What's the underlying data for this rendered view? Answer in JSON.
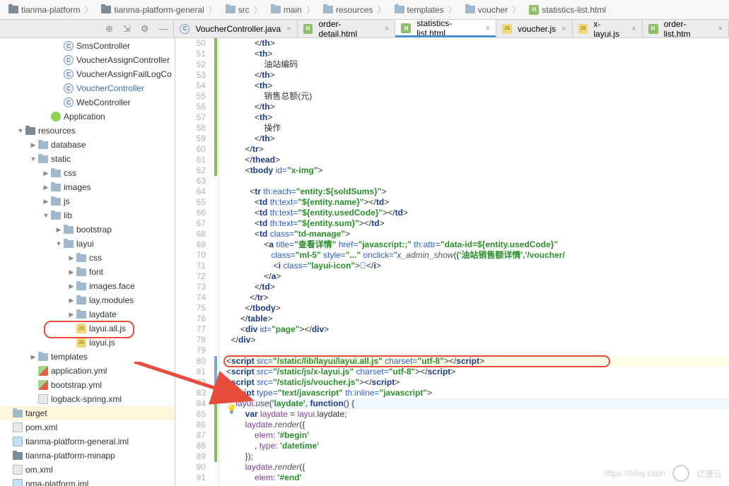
{
  "breadcrumb": [
    {
      "icon": "folder-dark",
      "label": "tianma-platform"
    },
    {
      "icon": "folder-dark",
      "label": "tianma-platform-general"
    },
    {
      "icon": "folder",
      "label": "src"
    },
    {
      "icon": "folder",
      "label": "main"
    },
    {
      "icon": "folder",
      "label": "resources"
    },
    {
      "icon": "folder",
      "label": "templates"
    },
    {
      "icon": "folder",
      "label": "voucher"
    },
    {
      "icon": "html",
      "label": "statistics-list.html"
    }
  ],
  "tool_icons": [
    "target",
    "expand",
    "gear",
    "collapse"
  ],
  "tabs": {
    "items": [
      {
        "icon": "java",
        "label": "VoucherController.java",
        "active": false
      },
      {
        "icon": "html",
        "label": "order-detail.html",
        "active": false
      },
      {
        "icon": "html",
        "label": "statistics-list.html",
        "active": true
      },
      {
        "icon": "js",
        "label": "voucher.js",
        "active": false
      },
      {
        "icon": "js",
        "label": "x-layui.js",
        "active": false
      },
      {
        "icon": "html",
        "label": "order-list.htm",
        "active": false
      }
    ]
  },
  "tree": [
    {
      "d": 4,
      "a": "",
      "i": "java",
      "t": "SmsController",
      "link": false
    },
    {
      "d": 4,
      "a": "",
      "i": "java",
      "t": "VoucherAssignController",
      "link": false,
      "trunc": true
    },
    {
      "d": 4,
      "a": "",
      "i": "java",
      "t": "VoucherAssignFailLogCo",
      "link": false,
      "trunc": true
    },
    {
      "d": 4,
      "a": "",
      "i": "java",
      "t": "VoucherController",
      "link": true
    },
    {
      "d": 4,
      "a": "",
      "i": "java",
      "t": "WebController",
      "link": false
    },
    {
      "d": 3,
      "a": "",
      "i": "spring",
      "t": "Application",
      "link": false
    },
    {
      "d": 1,
      "a": "▼",
      "i": "folder-dark",
      "t": "resources",
      "link": false
    },
    {
      "d": 2,
      "a": "▶",
      "i": "folder",
      "t": "database",
      "link": false
    },
    {
      "d": 2,
      "a": "▼",
      "i": "folder",
      "t": "static",
      "link": false
    },
    {
      "d": 3,
      "a": "▶",
      "i": "folder",
      "t": "css",
      "link": false
    },
    {
      "d": 3,
      "a": "▶",
      "i": "folder",
      "t": "images",
      "link": false
    },
    {
      "d": 3,
      "a": "▶",
      "i": "folder",
      "t": "js",
      "link": false
    },
    {
      "d": 3,
      "a": "▼",
      "i": "folder",
      "t": "lib",
      "link": false
    },
    {
      "d": 4,
      "a": "▶",
      "i": "folder",
      "t": "bootstrap",
      "link": false
    },
    {
      "d": 4,
      "a": "▼",
      "i": "folder",
      "t": "layui",
      "link": false
    },
    {
      "d": 5,
      "a": "▶",
      "i": "folder",
      "t": "css",
      "link": false
    },
    {
      "d": 5,
      "a": "▶",
      "i": "folder",
      "t": "font",
      "link": false
    },
    {
      "d": 5,
      "a": "▶",
      "i": "folder",
      "t": "images.face",
      "link": false
    },
    {
      "d": 5,
      "a": "▶",
      "i": "folder",
      "t": "lay.modules",
      "link": false
    },
    {
      "d": 5,
      "a": "▶",
      "i": "folder",
      "t": "laydate",
      "link": false
    },
    {
      "d": 5,
      "a": "",
      "i": "js",
      "t": "layui.all.js",
      "link": false,
      "hl": true
    },
    {
      "d": 5,
      "a": "",
      "i": "js",
      "t": "layui.js",
      "link": false
    },
    {
      "d": 2,
      "a": "▶",
      "i": "folder",
      "t": "templates",
      "link": false
    },
    {
      "d": 2,
      "a": "",
      "i": "yml",
      "t": "application.yml",
      "link": false
    },
    {
      "d": 2,
      "a": "",
      "i": "yml",
      "t": "bootstrap.yml",
      "link": false
    },
    {
      "d": 2,
      "a": "",
      "i": "xml",
      "t": "logback-spring.xml",
      "link": false
    },
    {
      "d": 0,
      "a": "",
      "i": "folder",
      "t": "target",
      "link": false,
      "sel": true
    },
    {
      "d": 0,
      "a": "",
      "i": "xml",
      "t": "pom.xml",
      "link": false
    },
    {
      "d": 0,
      "a": "",
      "i": "iml",
      "t": "tianma-platform-general.iml",
      "link": false
    },
    {
      "d": 0,
      "a": "",
      "i": "folder-dark",
      "t": "tianma-platform-minapp",
      "link": false
    },
    {
      "d": 0,
      "a": "",
      "i": "xml",
      "t": "om.xml",
      "link": false
    },
    {
      "d": 0,
      "a": "",
      "i": "iml",
      "t": "nma-platform.iml",
      "link": false
    }
  ],
  "gutter_start": 50,
  "gutter_end": 91,
  "highlighted_line": 80,
  "caret_line": 84,
  "code_text": {
    "th_close": "th",
    "th": "th",
    "text_youzhan": "油站编码",
    "text_sales": "销售总额(元)",
    "text_op": "操作",
    "tr": "tr",
    "thead": "thead",
    "tbody": "tbody",
    "id": "id=",
    "ximg": "\"x-img\"",
    "theach": "th:each=",
    "each_v": "\"entity:${soldSums}\"",
    "td": "td",
    "thtext": "th:text=",
    "ename": "\"${entity.name}\"",
    "eused": "\"${entity.usedCode}\"",
    "esum": "\"${entity.sum}\"",
    "class": "class=",
    "tdmanage": "\"td-manage\"",
    "a": "a",
    "title": "title=",
    "view": "\"查看详情\"",
    "href": "href=",
    "js_void": "\"javascript:;\"",
    "thattr": "th:attr=",
    "dataid": "\"data-id=${entity.usedCode}\"",
    "ml5": "\"ml-5\"",
    "style": "style=",
    "dots": "\"...\"",
    "onclick": "onclick=",
    "xshow": "x_admin_show",
    "args": "('油站销售额详情','/voucher/",
    "i": "i",
    "layuiicon": "\"layui-icon\"",
    "entity": "&#xe60a;",
    "table": "table",
    "div": "div",
    "page": "\"page\"",
    "script": "script",
    "src": "src=",
    "layui_src": "\"/static/lib/layui/layui.all.js\"",
    "charset": "charset=",
    "utf8": "\"utf-8\"",
    "xlayui_src": "\"/static/js/x-layui.js\"",
    "voucher_src": "\"/static/js/voucher.js\"",
    "type": "type=",
    "textjs": "\"text/javascript\"",
    "thinline": "th:inline=",
    "jsq": "\"javascript\"",
    "layui": "layui",
    "use": "use",
    "laydate_s": "'laydate'",
    "function": "function",
    "var": "var",
    "laydate": "laydate",
    "eq": " = ",
    "dot_laydate": ".laydate",
    "render": "render",
    "elem": "elem",
    "begin": "'#begin'",
    "type_k": "type",
    "datetime": "'datetime'",
    "end": "'#end'",
    "semicolon": ";"
  },
  "watermark": {
    "url": "https://blog.csdn",
    "brand": "亿速云"
  }
}
